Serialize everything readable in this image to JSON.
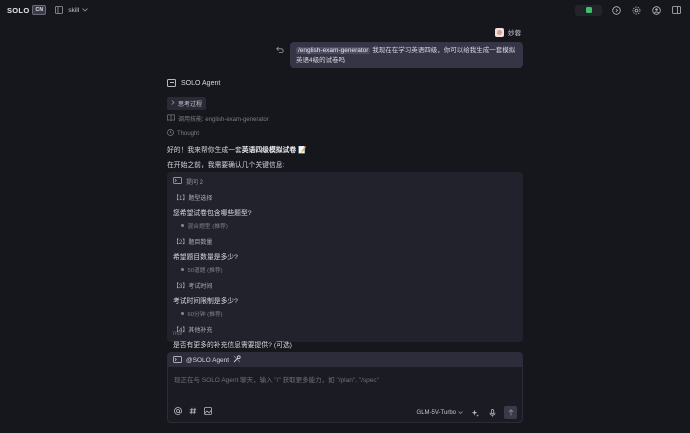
{
  "topbar": {
    "logo_text": "SOLO",
    "logo_badge": "CN",
    "workspace_name": "skill"
  },
  "user": {
    "name": "妙蓉"
  },
  "message": {
    "command": "/english-exam-generator",
    "text": "我现在在学习英语四级，你可以给我生成一套模拟英语4级的试卷吗"
  },
  "agent": {
    "name": "SOLO Agent",
    "process_chip": "思考过程",
    "skill_call": "调用技能: english-exam-generator",
    "thought": "Thought",
    "reply_prefix": "好的！我来帮你生成一套",
    "reply_bold": "英语四级模拟试卷",
    "reply_suffix": "📝",
    "reply_line2": "在开始之前，我需要确认几个关键信息:"
  },
  "card": {
    "header": "提问 2",
    "sections": [
      {
        "title": "【1】题型选择",
        "question": "您希望试卷包含哪些题型?",
        "answer": "混合题型 (推荐)"
      },
      {
        "title": "【2】题目数量",
        "question": "希望题目数量是多少?",
        "answer": "50道题 (推荐)"
      },
      {
        "title": "【3】考试时间",
        "question": "考试时间限制是多少?",
        "answer": "60分钟 (推荐)"
      },
      {
        "title": "【4】其他补充",
        "question": "是否有更多的补充信息需要提供?  (可选)",
        "answer": ""
      }
    ],
    "footer": "null"
  },
  "composer": {
    "mention": "@SOLO Agent",
    "placeholder": "现正在与 SOLO Agent 聊天，输入 \"/\" 获取更多能力，如 \"/plan\", \"/spec\"",
    "model": "GLM-5V-Turbo"
  }
}
